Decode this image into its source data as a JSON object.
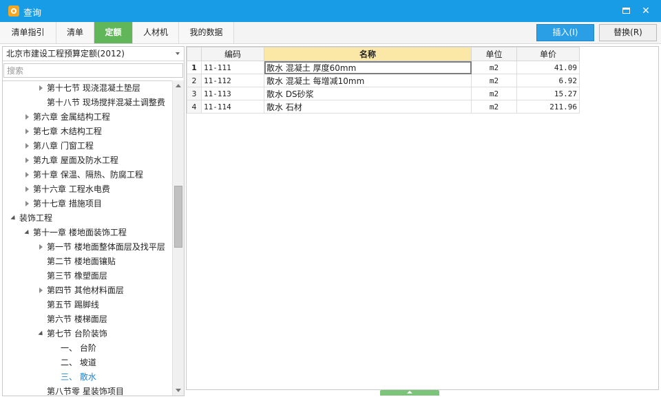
{
  "window": {
    "title": "查询"
  },
  "tabs": [
    {
      "label": "清单指引",
      "active": false
    },
    {
      "label": "清单",
      "active": false
    },
    {
      "label": "定额",
      "active": true
    },
    {
      "label": "人材机",
      "active": false
    },
    {
      "label": "我的数据",
      "active": false
    }
  ],
  "toolbar": {
    "insert_label": "插入(I)",
    "replace_label": "替换(R)"
  },
  "left": {
    "library_select": "北京市建设工程预算定额(2012)",
    "search_placeholder": "搜索",
    "tree": [
      {
        "label": "第十七节 现浇混凝土垫层",
        "level": 3,
        "state": "collapsed"
      },
      {
        "label": "第十八节 现场搅拌混凝土调整费",
        "level": 3,
        "state": "leaf"
      },
      {
        "label": "第六章 金属结构工程",
        "level": 2,
        "state": "collapsed"
      },
      {
        "label": "第七章 木结构工程",
        "level": 2,
        "state": "collapsed"
      },
      {
        "label": "第八章 门窗工程",
        "level": 2,
        "state": "collapsed"
      },
      {
        "label": "第九章 屋面及防水工程",
        "level": 2,
        "state": "collapsed"
      },
      {
        "label": "第十章 保温、隔热、防腐工程",
        "level": 2,
        "state": "collapsed"
      },
      {
        "label": "第十六章 工程水电费",
        "level": 2,
        "state": "collapsed"
      },
      {
        "label": "第十七章 措施项目",
        "level": 2,
        "state": "collapsed"
      },
      {
        "label": "装饰工程",
        "level": 1,
        "state": "expanded"
      },
      {
        "label": "第十一章 楼地面装饰工程",
        "level": 2,
        "state": "expanded"
      },
      {
        "label": "第一节 楼地面整体面层及找平层",
        "level": 3,
        "state": "collapsed"
      },
      {
        "label": "第二节 楼地面镶贴",
        "level": 3,
        "state": "leaf"
      },
      {
        "label": "第三节 橡塑面层",
        "level": 3,
        "state": "leaf"
      },
      {
        "label": "第四节 其他材料面层",
        "level": 3,
        "state": "collapsed"
      },
      {
        "label": "第五节 踢脚线",
        "level": 3,
        "state": "leaf"
      },
      {
        "label": "第六节 楼梯面层",
        "level": 3,
        "state": "leaf"
      },
      {
        "label": "第七节 台阶装饰",
        "level": 3,
        "state": "expanded"
      },
      {
        "label": "一、 台阶",
        "level": 4,
        "state": "leaf"
      },
      {
        "label": "二、 坡道",
        "level": 4,
        "state": "leaf"
      },
      {
        "label": "三、 散水",
        "level": 4,
        "state": "leaf",
        "selected": true
      },
      {
        "label": "第八节零 星装饰项目",
        "level": 3,
        "state": "leaf"
      }
    ]
  },
  "grid": {
    "headers": {
      "code": "编码",
      "name": "名称",
      "unit": "单位",
      "price": "单价"
    },
    "rows": [
      {
        "idx": "1",
        "code": "11-111",
        "name": "散水 混凝土 厚度60mm",
        "unit": "m2",
        "price": "41.09"
      },
      {
        "idx": "2",
        "code": "11-112",
        "name": "散水 混凝土 每增减10mm",
        "unit": "m2",
        "price": "6.92"
      },
      {
        "idx": "3",
        "code": "11-113",
        "name": "散水 DS砂浆",
        "unit": "m2",
        "price": "15.27"
      },
      {
        "idx": "4",
        "code": "11-114",
        "name": "散水 石材",
        "unit": "m2",
        "price": "211.96"
      }
    ]
  },
  "colors": {
    "titlebar": "#189ce6",
    "active_tab": "#62b65a",
    "primary_button": "#2b9fe6",
    "name_header": "#fbe7a6",
    "selected_tree": "#1a86d8"
  }
}
